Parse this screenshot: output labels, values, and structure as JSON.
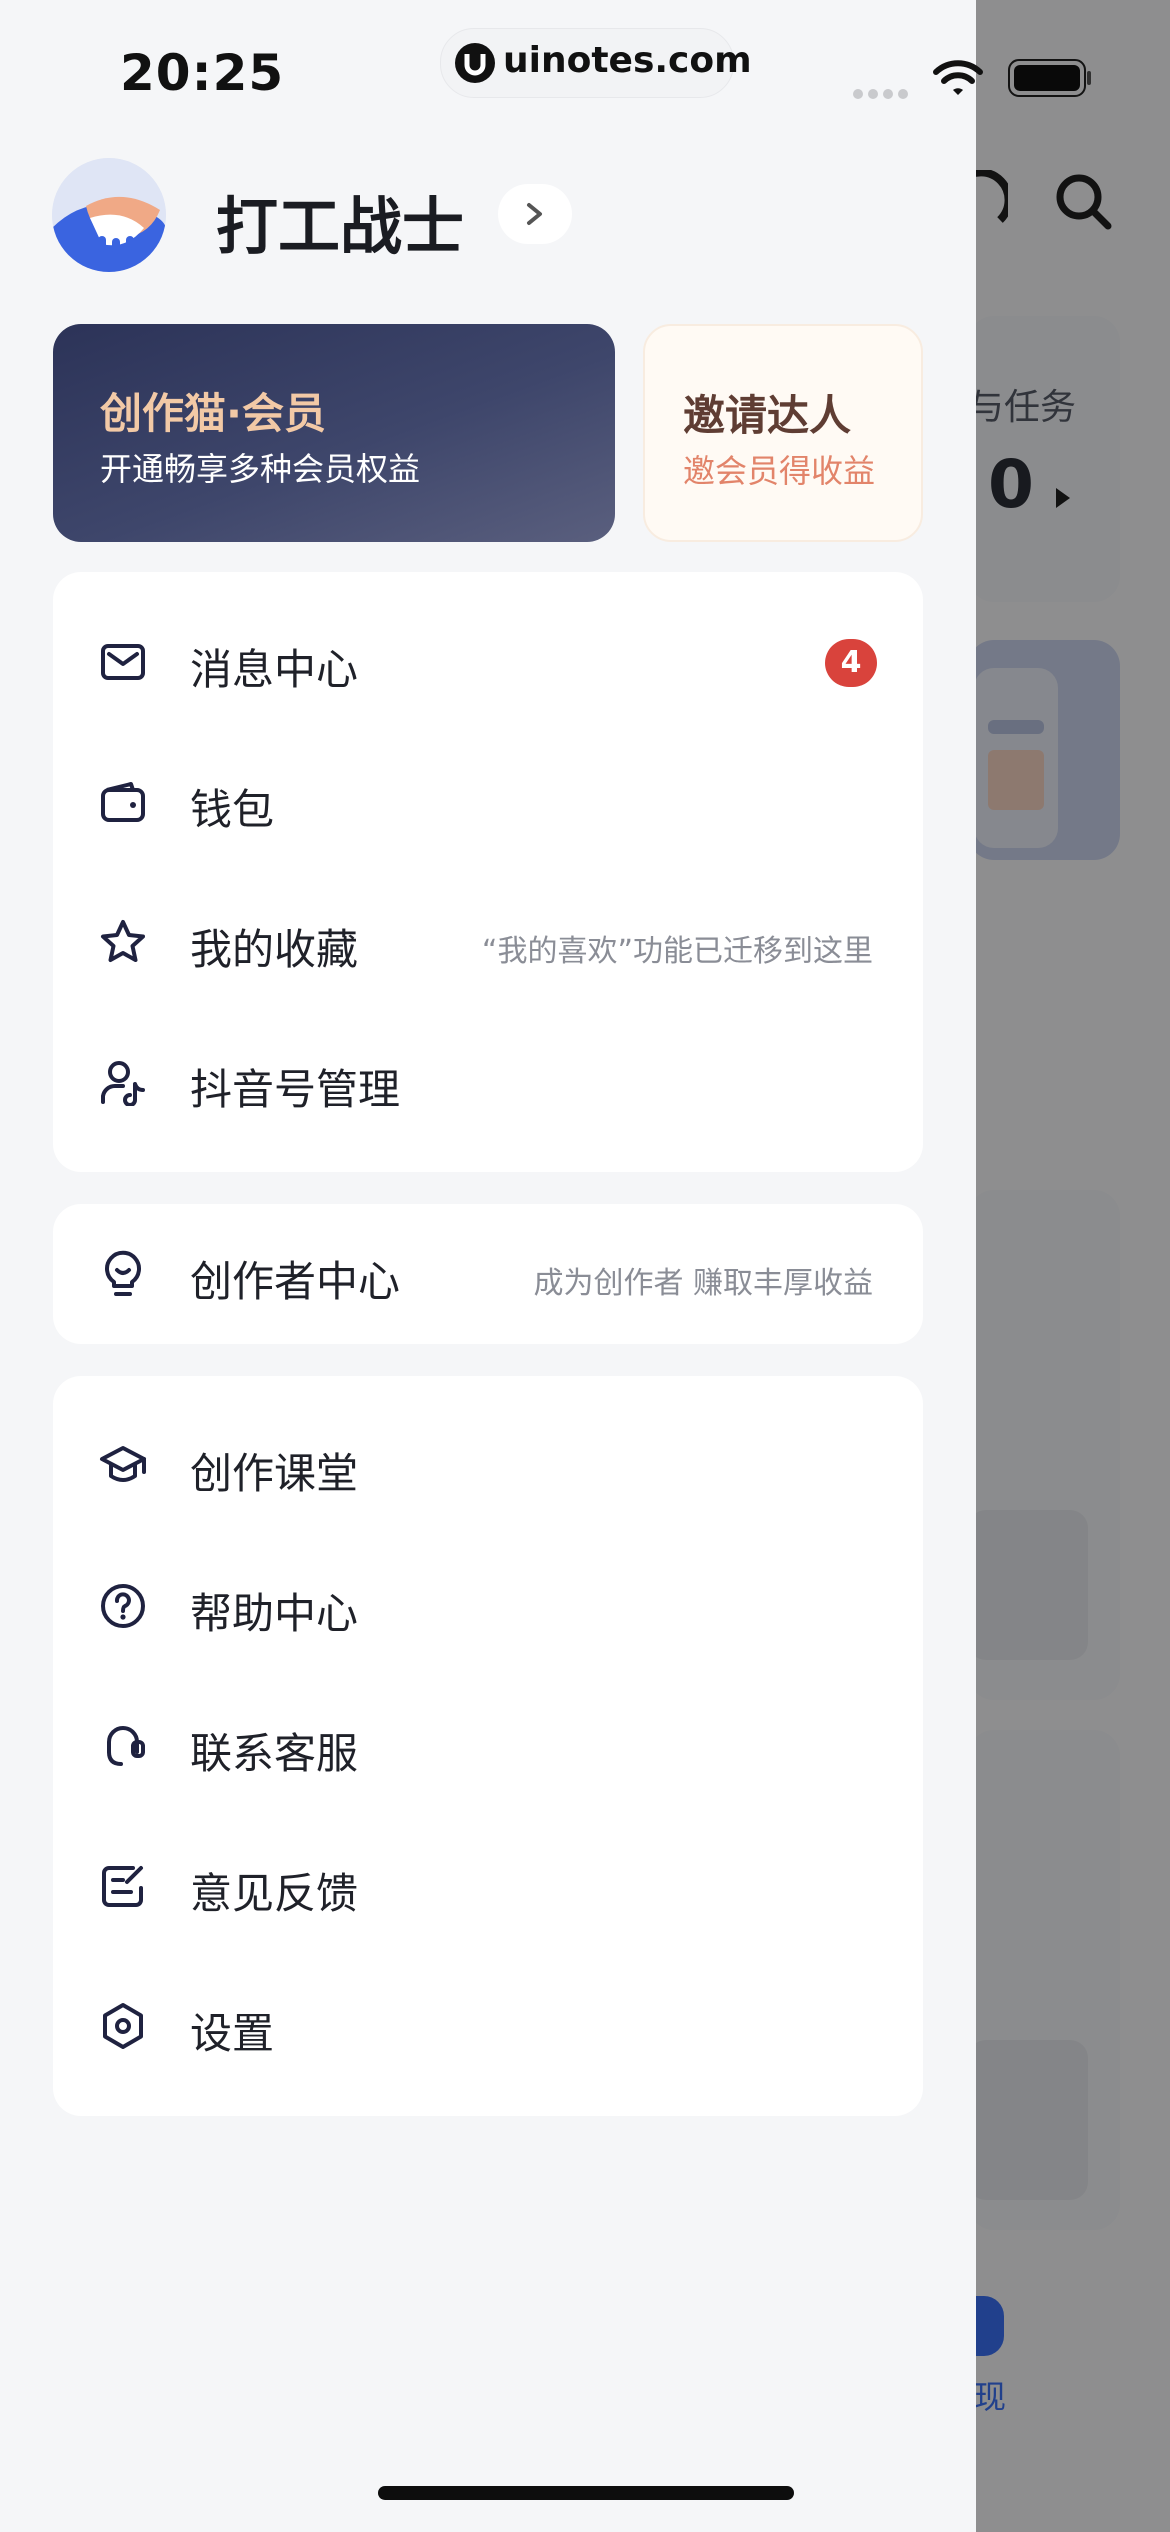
{
  "status_bar": {
    "time": "20:25",
    "url": "uinotes.com"
  },
  "profile": {
    "username": "打工战士",
    "arrow": "›"
  },
  "promo": {
    "vip_title": "创作猫·会员",
    "vip_subtitle": "开通畅享多种会员权益",
    "invite_title": "邀请达人",
    "invite_subtitle": "邀会员得收益"
  },
  "menu_group_1": [
    {
      "label": "消息中心",
      "icon": "mail-icon",
      "badge": "4"
    },
    {
      "label": "钱包",
      "icon": "wallet-icon"
    },
    {
      "label": "我的收藏",
      "icon": "star-icon",
      "hint": "“我的喜欢”功能已迁移到这里"
    },
    {
      "label": "抖音号管理",
      "icon": "user-tiktok-icon"
    }
  ],
  "menu_group_2": [
    {
      "label": "创作者中心",
      "icon": "lightbulb-icon",
      "hint": "成为创作者 赚取丰厚收益"
    }
  ],
  "menu_group_3": [
    {
      "label": "创作课堂",
      "icon": "graduation-cap-icon"
    },
    {
      "label": "帮助中心",
      "icon": "help-circle-icon"
    },
    {
      "label": "联系客服",
      "icon": "headset-icon"
    },
    {
      "label": "意见反馈",
      "icon": "feedback-icon"
    },
    {
      "label": "设置",
      "icon": "settings-hexagon-icon"
    }
  ],
  "background_page": {
    "task_label": "与任务",
    "task_value": "0",
    "tab_label": "现"
  },
  "colors": {
    "vip_gold": "#f2c9a6",
    "badge_red": "#d9433c",
    "invite_orange": "#e2846a",
    "icon_stroke": "#1f2240"
  }
}
